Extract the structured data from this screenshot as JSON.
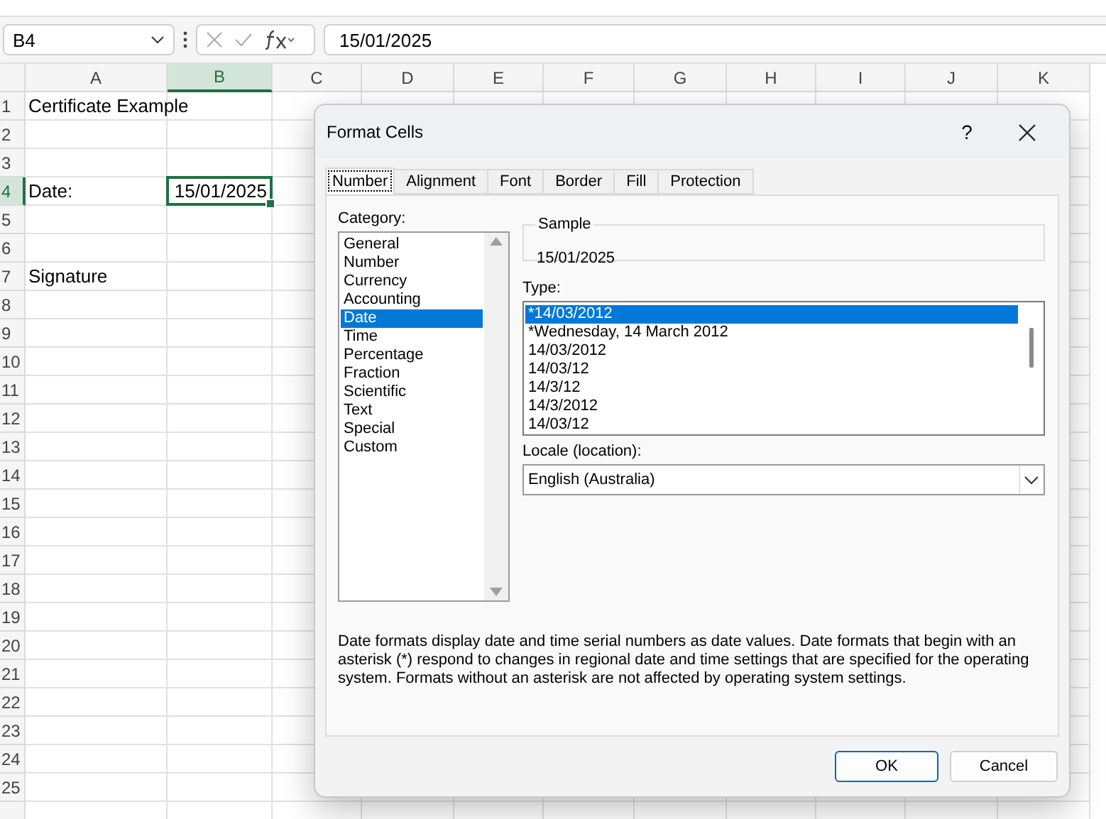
{
  "formula_bar": {
    "name_box": "B4",
    "formula": "15/01/2025"
  },
  "sheet": {
    "columns": [
      {
        "label": "A",
        "selected": false
      },
      {
        "label": "B",
        "selected": true
      },
      {
        "label": "C",
        "selected": false
      },
      {
        "label": "D",
        "selected": false
      },
      {
        "label": "E",
        "selected": false
      },
      {
        "label": "F",
        "selected": false
      },
      {
        "label": "G",
        "selected": false
      },
      {
        "label": "H",
        "selected": false
      },
      {
        "label": "I",
        "selected": false
      },
      {
        "label": "J",
        "selected": false
      },
      {
        "label": "K",
        "selected": false
      }
    ],
    "rows": [
      {
        "label": "1",
        "selected": false,
        "col_a": "Certificate Example"
      },
      {
        "label": "2",
        "selected": false
      },
      {
        "label": "3",
        "selected": false
      },
      {
        "label": "4",
        "selected": true,
        "col_a": "Date:",
        "col_b": "15/01/2025"
      },
      {
        "label": "5",
        "selected": false
      },
      {
        "label": "6",
        "selected": false
      },
      {
        "label": "7",
        "selected": false,
        "col_a": "Signature"
      },
      {
        "label": "8",
        "selected": false
      },
      {
        "label": "9",
        "selected": false
      },
      {
        "label": "10",
        "selected": false
      },
      {
        "label": "11",
        "selected": false
      },
      {
        "label": "12",
        "selected": false
      },
      {
        "label": "13",
        "selected": false
      },
      {
        "label": "14",
        "selected": false
      },
      {
        "label": "15",
        "selected": false
      },
      {
        "label": "16",
        "selected": false
      },
      {
        "label": "17",
        "selected": false
      },
      {
        "label": "18",
        "selected": false
      },
      {
        "label": "19",
        "selected": false
      },
      {
        "label": "20",
        "selected": false
      },
      {
        "label": "21",
        "selected": false
      },
      {
        "label": "22",
        "selected": false
      },
      {
        "label": "23",
        "selected": false
      },
      {
        "label": "24",
        "selected": false
      },
      {
        "label": "25",
        "selected": false
      }
    ]
  },
  "dialog": {
    "title": "Format Cells",
    "help": "?",
    "tabs": [
      {
        "label": "Number",
        "selected": true
      },
      {
        "label": "Alignment",
        "selected": false
      },
      {
        "label": "Font",
        "selected": false
      },
      {
        "label": "Border",
        "selected": false
      },
      {
        "label": "Fill",
        "selected": false
      },
      {
        "label": "Protection",
        "selected": false
      }
    ],
    "category_label": "Category:",
    "categories": [
      {
        "label": "General",
        "selected": false
      },
      {
        "label": "Number",
        "selected": false
      },
      {
        "label": "Currency",
        "selected": false
      },
      {
        "label": "Accounting",
        "selected": false
      },
      {
        "label": "Date",
        "selected": true
      },
      {
        "label": "Time",
        "selected": false
      },
      {
        "label": "Percentage",
        "selected": false
      },
      {
        "label": "Fraction",
        "selected": false
      },
      {
        "label": "Scientific",
        "selected": false
      },
      {
        "label": "Text",
        "selected": false
      },
      {
        "label": "Special",
        "selected": false
      },
      {
        "label": "Custom",
        "selected": false
      }
    ],
    "sample_label": "Sample",
    "sample_value": "15/01/2025",
    "type_label": "Type:",
    "types": [
      {
        "label": "*14/03/2012",
        "selected": true
      },
      {
        "label": "*Wednesday, 14 March 2012",
        "selected": false
      },
      {
        "label": "14/03/2012",
        "selected": false
      },
      {
        "label": "14/03/12",
        "selected": false
      },
      {
        "label": "14/3/12",
        "selected": false
      },
      {
        "label": "14/3/2012",
        "selected": false
      },
      {
        "label": "14/03/12",
        "selected": false
      }
    ],
    "locale_label": "Locale (location):",
    "locale_value": "English (Australia)",
    "description": "Date formats display date and time serial numbers as date values.  Date formats that begin with an asterisk (*) respond to changes in regional date and time settings that are specified for the operating system. Formats without an asterisk are not affected by operating system settings.",
    "buttons": [
      "OK",
      "Cancel"
    ]
  }
}
